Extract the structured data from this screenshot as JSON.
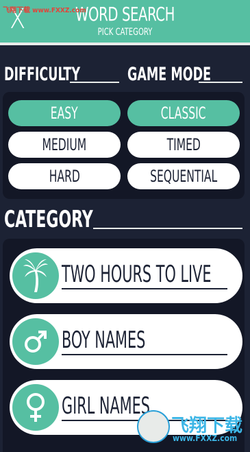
{
  "watermark": {
    "top_text": "飞翔下载 www.FXXZ.com",
    "brand_cn": "飞翔下载",
    "url": "www.FXXZ.com"
  },
  "header": {
    "close_label": "X",
    "title": "WORD SEARCH",
    "subtitle": "PICK CATEGORY",
    "accent_color": "#56bfa2"
  },
  "difficulty": {
    "label": "DIFFICULTY",
    "options": [
      "EASY",
      "MEDIUM",
      "HARD"
    ],
    "selected": "EASY"
  },
  "game_mode": {
    "label": "GAME MODE",
    "options": [
      "CLASSIC",
      "TIMED",
      "SEQUENTIAL"
    ],
    "selected": "CLASSIC"
  },
  "category": {
    "label": "CATEGORY",
    "items": [
      {
        "label": "TWO HOURS TO LIVE",
        "icon": "palm-tree-icon"
      },
      {
        "label": "BOY NAMES",
        "icon": "male-symbol-icon"
      },
      {
        "label": "GIRL NAMES",
        "icon": "female-symbol-icon"
      }
    ]
  }
}
